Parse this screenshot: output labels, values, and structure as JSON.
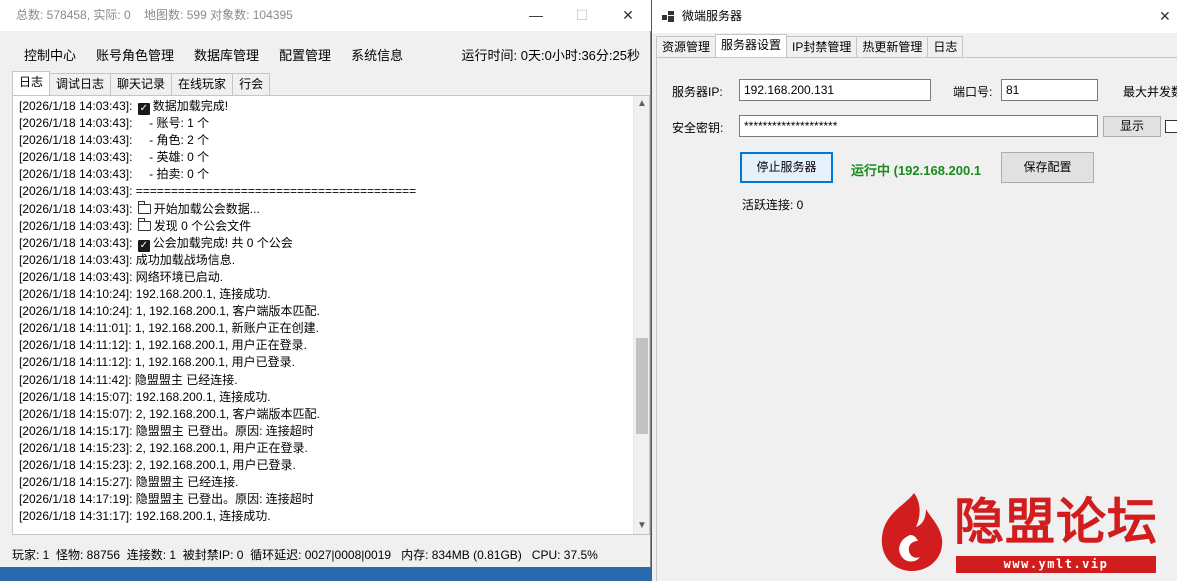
{
  "left_window": {
    "title": "总数: 578458, 实际: 0    地图数: 599 对象数: 104395",
    "controls": {
      "minimize": "—",
      "maximize": "☐",
      "close": "✕"
    },
    "menu": [
      "控制中心",
      "账号角色管理",
      "数据库管理",
      "配置管理",
      "系统信息"
    ],
    "runtime": "运行时间: 0天:0小时:36分:25秒",
    "tabs": [
      "日志",
      "调试日志",
      "聊天记录",
      "在线玩家",
      "行会"
    ],
    "active_tab": "日志",
    "log": [
      {
        "ts": "[2026/1/18 14:03:43]:",
        "icon": "check",
        "msg": "数据加载完成!"
      },
      {
        "ts": "[2026/1/18 14:03:43]:",
        "icon": "",
        "msg": "    - 账号: 1 个"
      },
      {
        "ts": "[2026/1/18 14:03:43]:",
        "icon": "",
        "msg": "    - 角色: 2 个"
      },
      {
        "ts": "[2026/1/18 14:03:43]:",
        "icon": "",
        "msg": "    - 英雄: 0 个"
      },
      {
        "ts": "[2026/1/18 14:03:43]:",
        "icon": "",
        "msg": "    - 拍卖: 0 个"
      },
      {
        "ts": "[2026/1/18 14:03:43]:",
        "icon": "",
        "msg": "========================================"
      },
      {
        "ts": "[2026/1/18 14:03:43]:",
        "icon": "folder",
        "msg": "开始加载公会数据..."
      },
      {
        "ts": "[2026/1/18 14:03:43]:",
        "icon": "folder",
        "msg": "发现 0 个公会文件"
      },
      {
        "ts": "[2026/1/18 14:03:43]:",
        "icon": "check",
        "msg": "公会加载完成! 共 0 个公会"
      },
      {
        "ts": "[2026/1/18 14:03:43]:",
        "icon": "",
        "msg": "成功加载战场信息."
      },
      {
        "ts": "[2026/1/18 14:03:43]:",
        "icon": "",
        "msg": "网络环境已启动."
      },
      {
        "ts": "[2026/1/18 14:10:24]:",
        "icon": "",
        "msg": "192.168.200.1, 连接成功."
      },
      {
        "ts": "[2026/1/18 14:10:24]:",
        "icon": "",
        "msg": "1, 192.168.200.1, 客户端版本匹配."
      },
      {
        "ts": "[2026/1/18 14:11:01]:",
        "icon": "",
        "msg": "1, 192.168.200.1, 新账户正在创建."
      },
      {
        "ts": "[2026/1/18 14:11:12]:",
        "icon": "",
        "msg": "1, 192.168.200.1, 用户正在登录."
      },
      {
        "ts": "[2026/1/18 14:11:12]:",
        "icon": "",
        "msg": "1, 192.168.200.1, 用户已登录."
      },
      {
        "ts": "[2026/1/18 14:11:42]:",
        "icon": "",
        "msg": "隐盟盟主 已经连接."
      },
      {
        "ts": "[2026/1/18 14:15:07]:",
        "icon": "",
        "msg": "192.168.200.1, 连接成功."
      },
      {
        "ts": "[2026/1/18 14:15:07]:",
        "icon": "",
        "msg": "2, 192.168.200.1, 客户端版本匹配."
      },
      {
        "ts": "[2026/1/18 14:15:17]:",
        "icon": "",
        "msg": "隐盟盟主 已登出。原因: 连接超时"
      },
      {
        "ts": "[2026/1/18 14:15:23]:",
        "icon": "",
        "msg": "2, 192.168.200.1, 用户正在登录."
      },
      {
        "ts": "[2026/1/18 14:15:23]:",
        "icon": "",
        "msg": "2, 192.168.200.1, 用户已登录."
      },
      {
        "ts": "[2026/1/18 14:15:27]:",
        "icon": "",
        "msg": "隐盟盟主 已经连接."
      },
      {
        "ts": "[2026/1/18 14:17:19]:",
        "icon": "",
        "msg": "隐盟盟主 已登出。原因: 连接超时"
      },
      {
        "ts": "[2026/1/18 14:31:17]:",
        "icon": "",
        "msg": "192.168.200.1, 连接成功."
      }
    ],
    "status": "玩家: 1  怪物: 88756  连接数: 1  被封禁IP: 0  循环延迟: 0027|0008|0019   内存: 834MB (0.81GB)   CPU: 37.5%"
  },
  "right_window": {
    "title": "微端服务器",
    "close": "✕",
    "tabs": [
      "资源管理",
      "服务器设置",
      "IP封禁管理",
      "热更新管理",
      "日志"
    ],
    "active_tab": "服务器设置",
    "server_ip_label": "服务器IP:",
    "server_ip_value": "192.168.200.131",
    "port_label": "端口号:",
    "port_value": "81",
    "max_conn_label": "最大并发数",
    "secret_label": "安全密钥:",
    "secret_value": "********************",
    "show_button": "显示",
    "stop_button": "停止服务器",
    "running_status": "运行中 (192.168.200.1",
    "save_button": "保存配置",
    "active_connections": "活跃连接: 0"
  },
  "watermark": {
    "brand": "隐盟论坛",
    "url": "www.ymlt.vip",
    "color": "#d11d1d"
  }
}
